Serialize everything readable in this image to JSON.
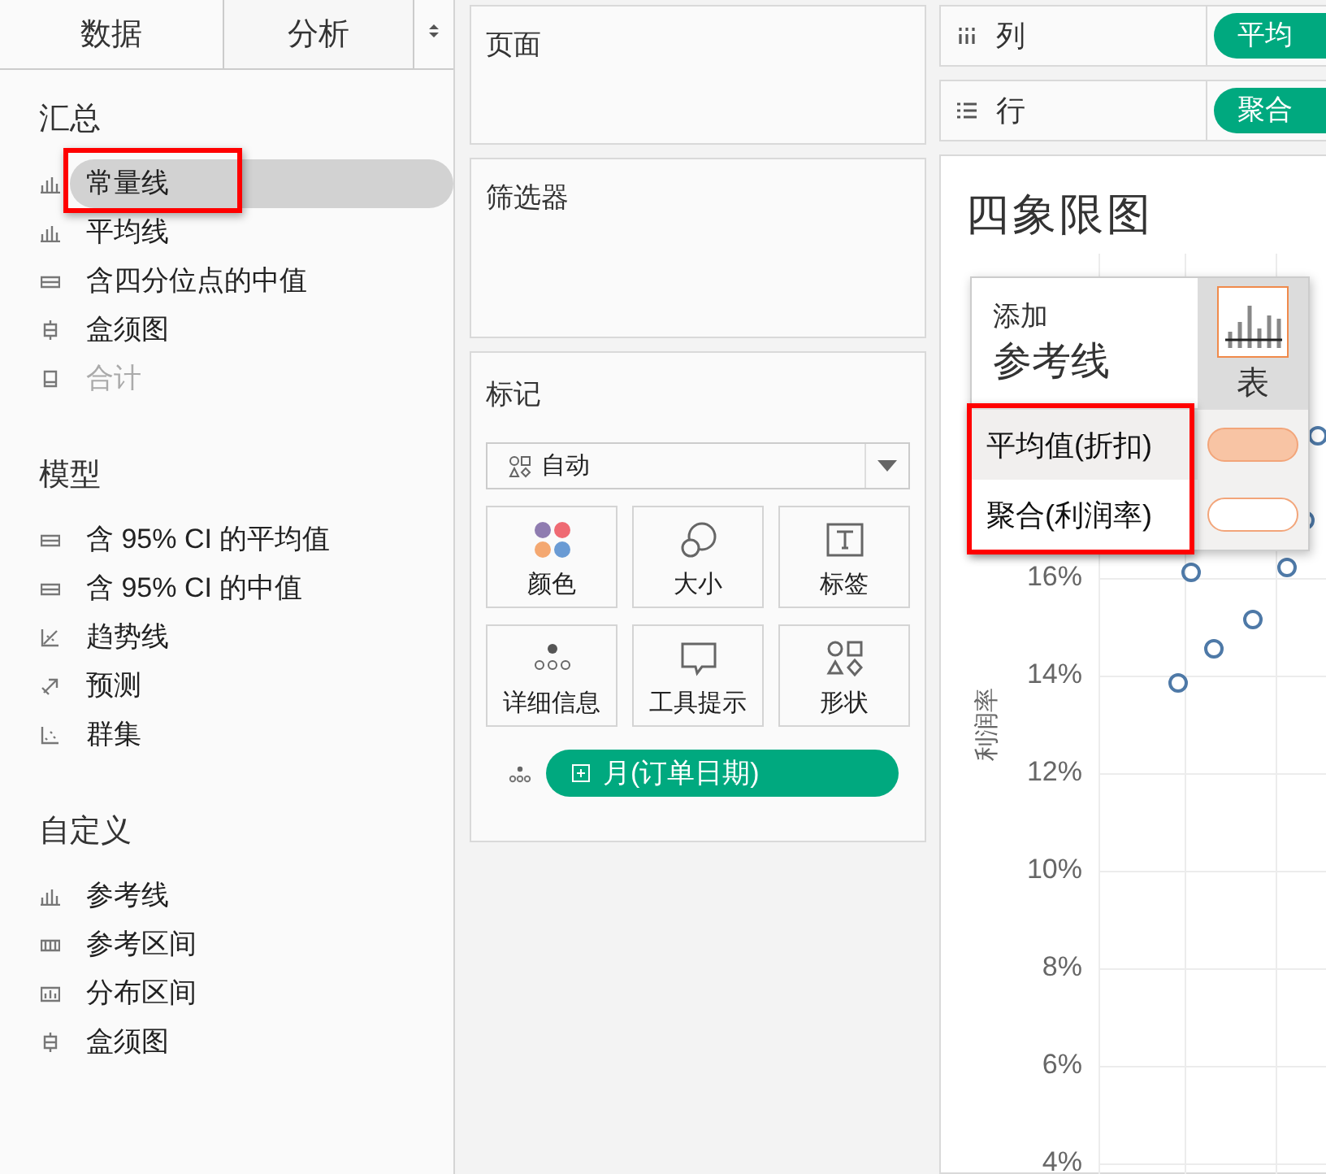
{
  "tabs": [
    {
      "label": "数据",
      "selected": false
    },
    {
      "label": "分析",
      "selected": true
    }
  ],
  "sidebar_sections": [
    {
      "title": "汇总",
      "items": [
        {
          "label": "常量线",
          "kind": "bars",
          "selected": true,
          "disabled": false,
          "highlighted": true
        },
        {
          "label": "平均线",
          "kind": "bars",
          "selected": false,
          "disabled": false,
          "highlighted": false
        },
        {
          "label": "含四分位点的中值",
          "kind": "band",
          "selected": false,
          "disabled": false,
          "highlighted": false
        },
        {
          "label": "盒须图",
          "kind": "box",
          "selected": false,
          "disabled": false,
          "highlighted": false
        },
        {
          "label": "合计",
          "kind": "total",
          "selected": false,
          "disabled": true,
          "highlighted": false
        }
      ]
    },
    {
      "title": "模型",
      "items": [
        {
          "label": "含 95% CI 的平均值",
          "kind": "band",
          "selected": false,
          "disabled": false,
          "highlighted": false
        },
        {
          "label": "含 95% CI 的中值",
          "kind": "band",
          "selected": false,
          "disabled": false,
          "highlighted": false
        },
        {
          "label": "趋势线",
          "kind": "trend",
          "selected": false,
          "disabled": false,
          "highlighted": false
        },
        {
          "label": "预测",
          "kind": "forecast",
          "selected": false,
          "disabled": false,
          "highlighted": false
        },
        {
          "label": "群集",
          "kind": "cluster",
          "selected": false,
          "disabled": false,
          "highlighted": false
        }
      ]
    },
    {
      "title": "自定义",
      "items": [
        {
          "label": "参考线",
          "kind": "bars",
          "selected": false,
          "disabled": false,
          "highlighted": false
        },
        {
          "label": "参考区间",
          "kind": "refband",
          "selected": false,
          "disabled": false,
          "highlighted": false
        },
        {
          "label": "分布区间",
          "kind": "distribution",
          "selected": false,
          "disabled": false,
          "highlighted": false
        },
        {
          "label": "盒须图",
          "kind": "box",
          "selected": false,
          "disabled": false,
          "highlighted": false
        }
      ]
    }
  ],
  "pages_shelf": {
    "title": "页面"
  },
  "filters_shelf": {
    "title": "筛选器"
  },
  "marks": {
    "title": "标记",
    "mark_type": "自动",
    "cards": [
      {
        "label": "颜色",
        "kind": "color"
      },
      {
        "label": "大小",
        "kind": "size"
      },
      {
        "label": "标签",
        "kind": "label"
      },
      {
        "label": "详细信息",
        "kind": "detail"
      },
      {
        "label": "工具提示",
        "kind": "tooltip"
      },
      {
        "label": "形状",
        "kind": "shape"
      }
    ],
    "field_pill": "月(订单日期)"
  },
  "columns_shelf": {
    "label": "列",
    "pill": "平均"
  },
  "rows_shelf": {
    "label": "行",
    "pill": "聚合"
  },
  "view": {
    "title": "四象限图",
    "y_axis_title": "利润率",
    "y_ticks": [
      "16%",
      "14%",
      "12%",
      "10%",
      "8%",
      "6%",
      "4%"
    ]
  },
  "popup": {
    "small_title": "添加",
    "title": "参考线",
    "tab": "表",
    "highlighted": true,
    "options": [
      {
        "label": "平均值(折扣)",
        "color": "#f8c4a4",
        "selected": true
      },
      {
        "label": "聚合(利润率)",
        "color": "#ffffff",
        "selected": false
      }
    ]
  }
}
